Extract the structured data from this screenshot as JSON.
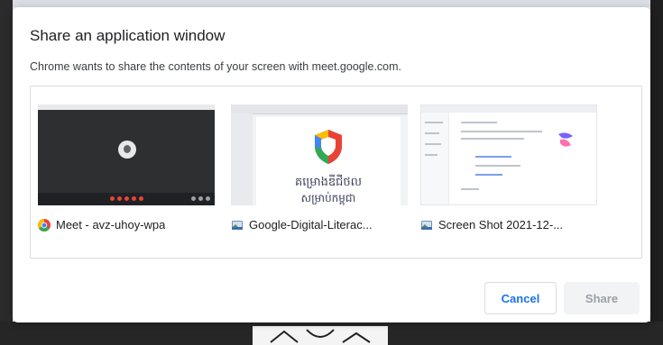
{
  "dialog": {
    "title": "Share an application window",
    "subtitle": "Chrome wants to share the contents of your screen with meet.google.com."
  },
  "sources": [
    {
      "label": "Meet - avz-uhoy-wpa",
      "icon": "chrome-icon"
    },
    {
      "label": "Google-Digital-Literac...",
      "icon": "preview-app-icon",
      "thumbnail_text": [
        "គម្រោងឌីជីថល",
        "សម្រាប់កម្ពុជា"
      ]
    },
    {
      "label": "Screen Shot 2021-12-...",
      "icon": "preview-app-icon"
    }
  ],
  "buttons": {
    "cancel": "Cancel",
    "share": "Share"
  },
  "colors": {
    "accent": "#1a73e8",
    "disabled_text": "#9aa0a6",
    "disabled_bg": "#f1f3f4"
  }
}
